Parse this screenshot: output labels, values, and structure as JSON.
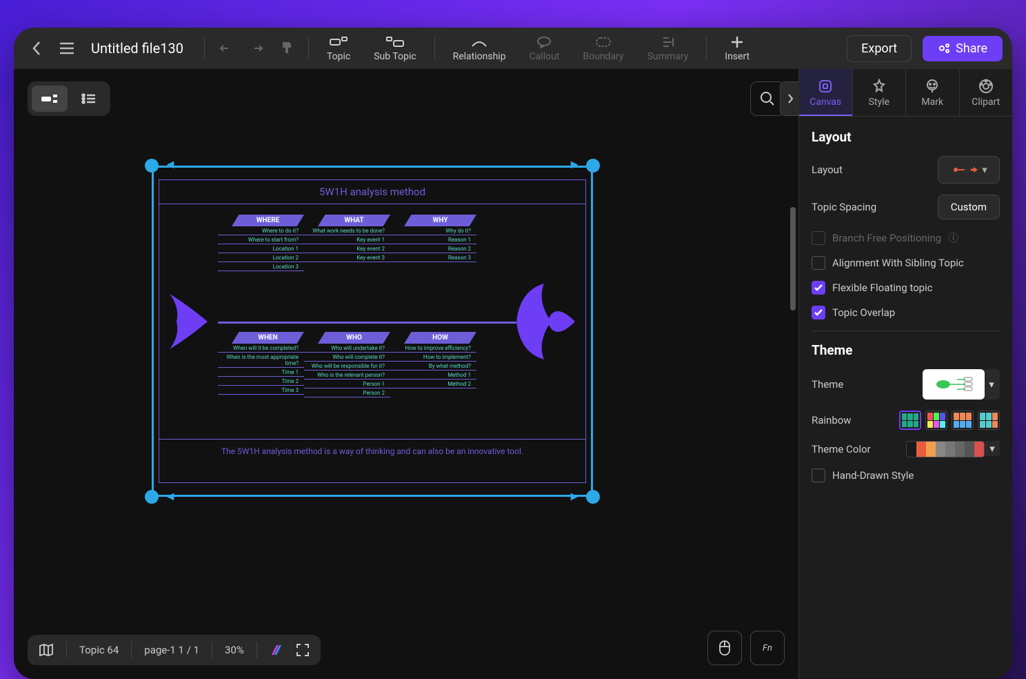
{
  "header": {
    "title": "Untitled file130",
    "tools": {
      "topic": "Topic",
      "subtopic": "Sub Topic",
      "relationship": "Relationship",
      "callout": "Callout",
      "boundary": "Boundary",
      "summary": "Summary",
      "insert": "Insert"
    },
    "export": "Export",
    "share": "Share"
  },
  "sidebar": {
    "tabs": {
      "canvas": "Canvas",
      "style": "Style",
      "mark": "Mark",
      "clipart": "Clipart"
    },
    "layout": {
      "section_title": "Layout",
      "layout_label": "Layout",
      "spacing_label": "Topic Spacing",
      "spacing_button": "Custom",
      "branch_free": "Branch Free Positioning",
      "alignment": "Alignment With Sibling Topic",
      "flexible": "Flexible Floating topic",
      "overlap": "Topic Overlap"
    },
    "theme": {
      "section_title": "Theme",
      "theme_label": "Theme",
      "rainbow_label": "Rainbow",
      "color_label": "Theme Color",
      "handdrawn": "Hand-Drawn Style",
      "theme_colors": [
        "#1a1a1a",
        "#e85d3d",
        "#f0a050",
        "#888",
        "#777",
        "#666",
        "#555",
        "#d85050"
      ]
    }
  },
  "diagram": {
    "title": "5W1H analysis method",
    "footer": "The 5W1H analysis method is a way of thinking and can also be an innovative tool.",
    "bones": {
      "where": {
        "h": "WHERE",
        "items": [
          "Where to do it?",
          "Where to start from?",
          "Location 1",
          "Location 2",
          "Location 3"
        ]
      },
      "what": {
        "h": "WHAT",
        "items": [
          "What work needs to be done?",
          "Key event 1",
          "Key event 2",
          "Key event 3"
        ]
      },
      "why": {
        "h": "WHY",
        "items": [
          "Why do it?",
          "Reason 1",
          "Reason 2",
          "Reason 3"
        ]
      },
      "when": {
        "h": "WHEN",
        "items": [
          "When will it be completed?",
          "When is the most appropriate time?",
          "Time 1",
          "Time 2",
          "Time 3"
        ]
      },
      "who": {
        "h": "WHO",
        "items": [
          "Who will undertake it?",
          "Who will complete it?",
          "Who will be responsible for it?",
          "Who is the relevant person?",
          "Person 1",
          "Person 2"
        ]
      },
      "how": {
        "h": "HOW",
        "items": [
          "How to improve efficiency?",
          "How to implement?",
          "By what method?",
          "Method 1",
          "Method 2"
        ]
      }
    }
  },
  "statusbar": {
    "topic_count": "Topic 64",
    "page": "page-1  1 / 1",
    "zoom": "30%"
  }
}
